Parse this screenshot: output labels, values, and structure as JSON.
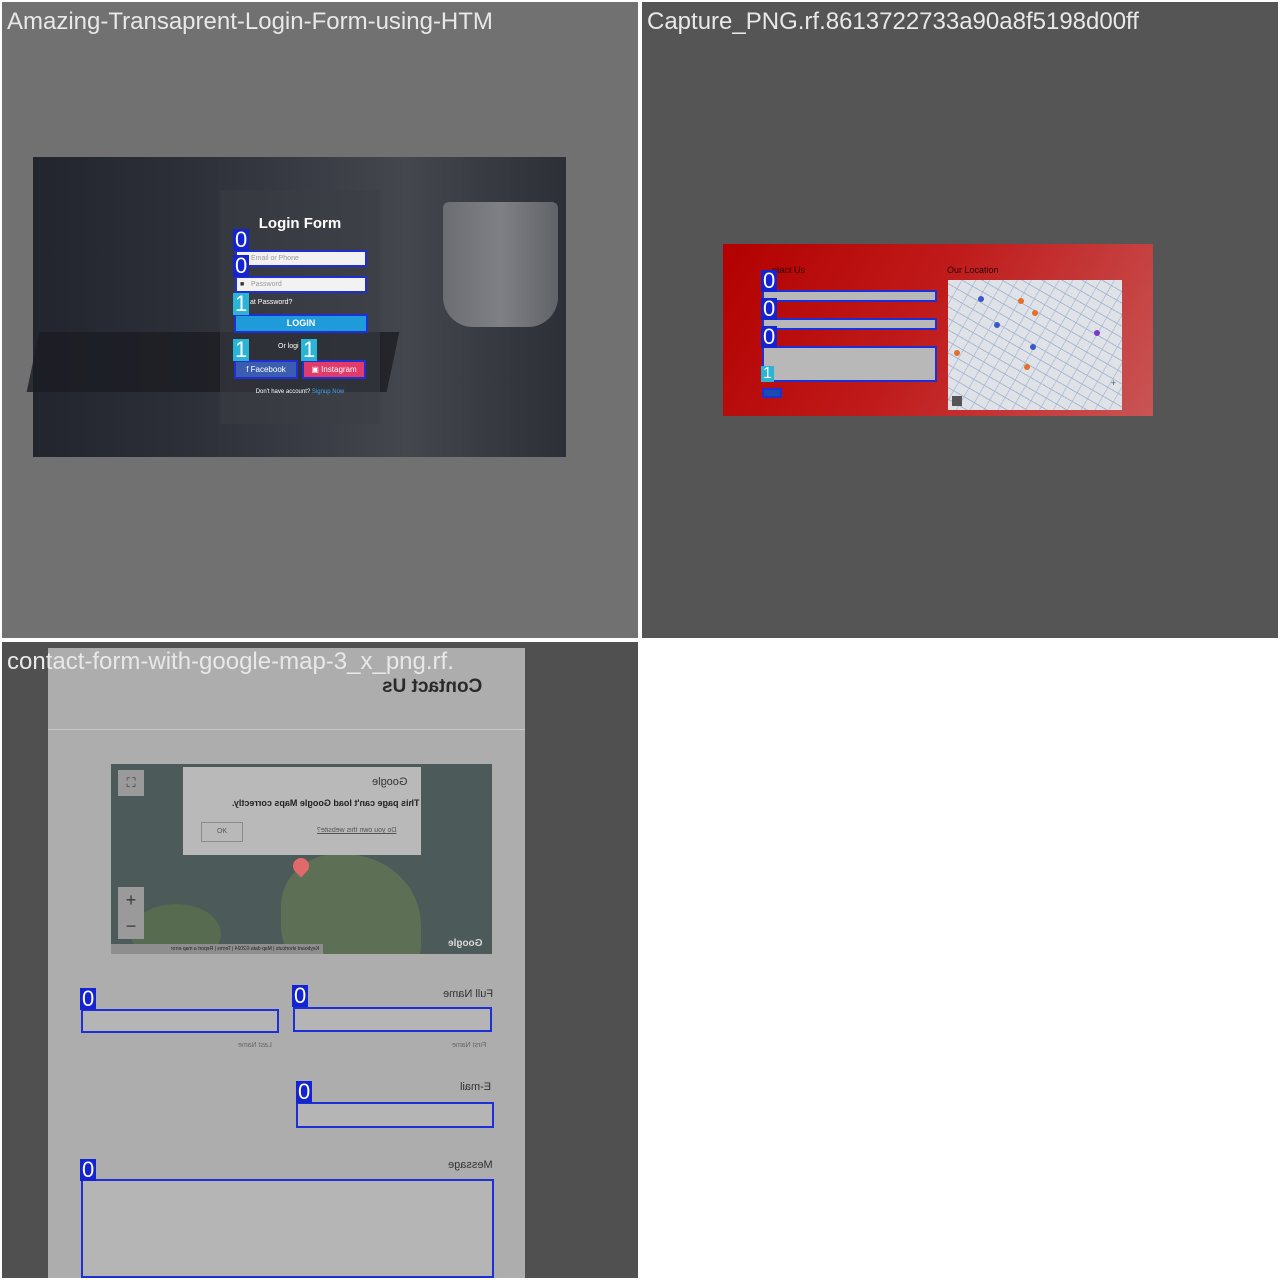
{
  "tiles": [
    {
      "title": "Amazing-Transaprent-Login-Form-using-HTM",
      "form_title": "Login Form",
      "email_placeholder": "Email or Phone",
      "password_placeholder": "Password",
      "forgot_text": "at Password?",
      "login_label": "LOGIN",
      "or_text": "Or logi",
      "or_text_tail": "n",
      "facebook_label": "f  Facebook",
      "instagram_label": "Instagram",
      "signup_text": "Don't have account?",
      "signup_link": "Signup Now",
      "annotations": [
        "0",
        "0",
        "1",
        "1",
        "1"
      ]
    },
    {
      "title": "Capture_PNG.rf.8613722733a90a8f5198d00ff",
      "contact_heading": "ntact Us",
      "location_heading": "Our Location",
      "annotations": [
        "0",
        "0",
        "0",
        "1"
      ]
    },
    {
      "title": "contact-form-with-google-map-3_x_png.rf.",
      "heading": "Contact Us",
      "map_dialog_title": "Google",
      "map_dialog_message": "This page can't load Google Maps correctly.",
      "map_dialog_ok": "OK",
      "map_dialog_own": "Do you own this website?",
      "map_footer": "Keyboard shortcuts | Map data ©2024 | Terms | Report a map error",
      "map_logo": "Google",
      "zoom_in": "+",
      "zoom_out": "−",
      "fullscreen": "⛶",
      "full_name_label": "Full Name",
      "first_name_hint": "First Name",
      "last_name_hint": "Last Name",
      "email_label": "E-mail",
      "message_label": "Message",
      "annotations": [
        "0",
        "0",
        "0",
        "0"
      ]
    }
  ],
  "colors": {
    "box_border": "#1f2fd6",
    "tag_class0": "#1424d0",
    "tag_class1": "#2ab5d6"
  }
}
